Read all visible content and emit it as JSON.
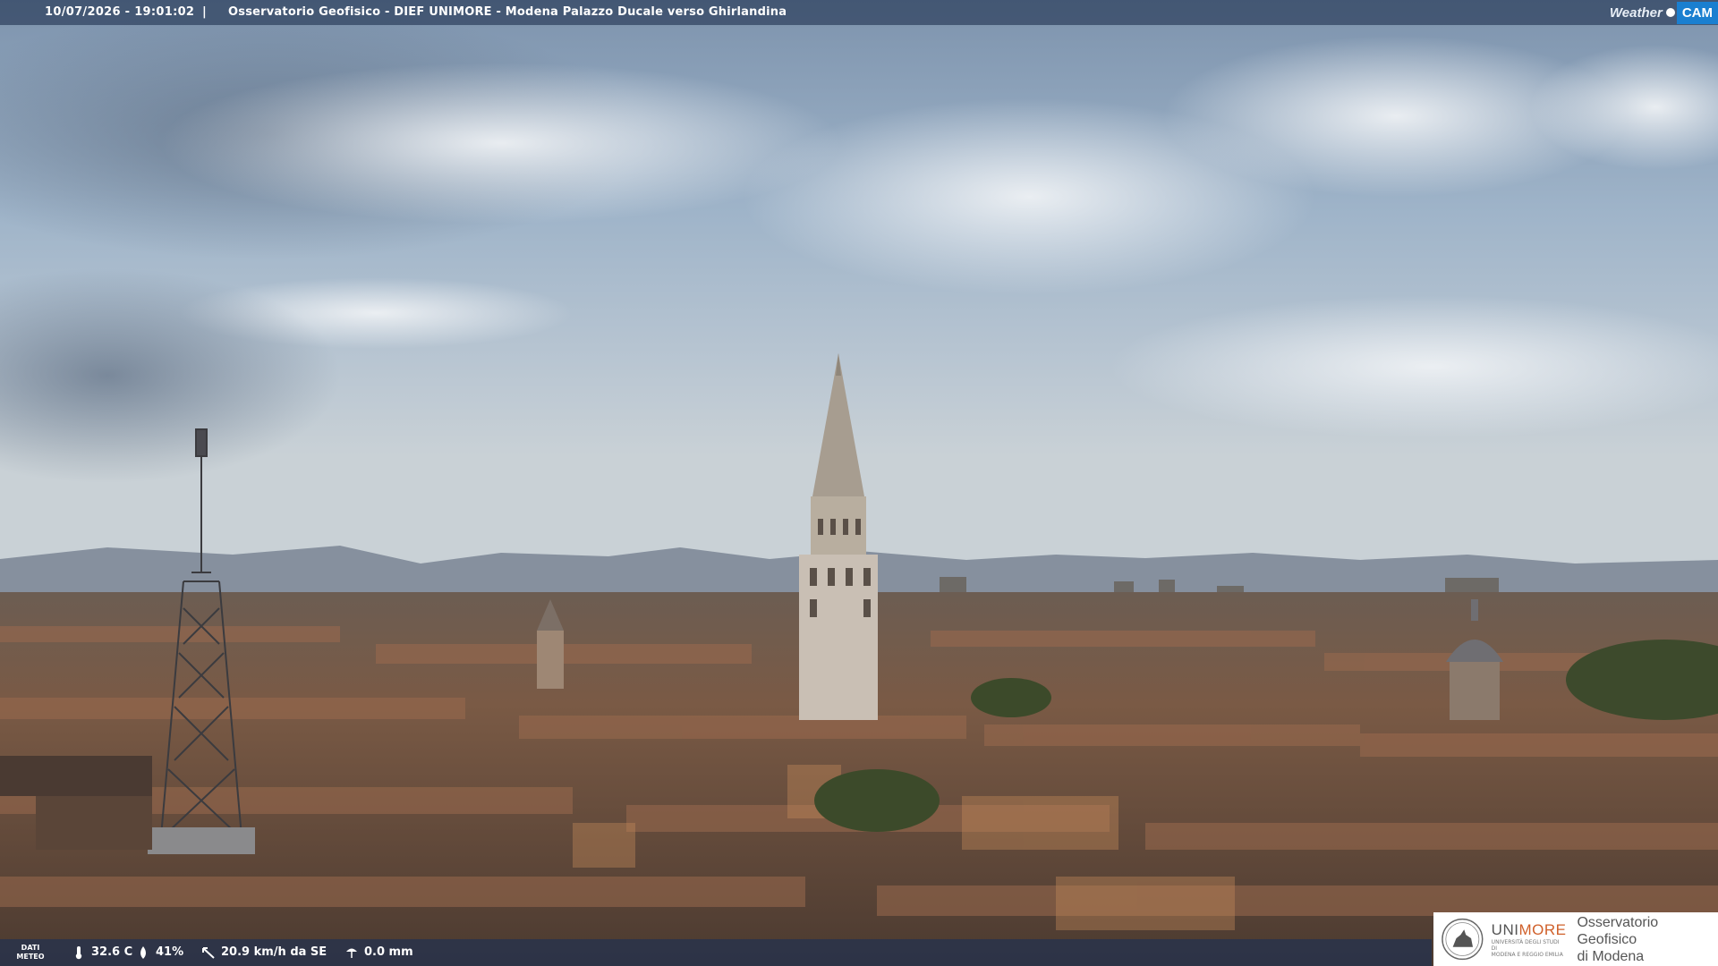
{
  "header": {
    "timestamp": "10/07/2026 - 19:01:02",
    "separator": "|",
    "title": "Osservatorio Geofisico - DIEF UNIMORE - Modena Palazzo Ducale verso Ghirlandina"
  },
  "logo": {
    "weather_text": "Weather",
    "cam_text": "CAM",
    "icon": "weathercam-logo"
  },
  "meteo": {
    "label_line1": "DATI",
    "label_line2": "METEO",
    "temperature": "32.6 C",
    "humidity": "41%",
    "wind": "20.9 km/h da SE",
    "rain": "0.0 mm",
    "icons": [
      "thermometer-icon",
      "humidity-drop-icon",
      "wind-icon",
      "rain-icon"
    ]
  },
  "brand": {
    "uni_prefix": "UNI",
    "uni_suffix": "MORE",
    "uni_sub_line1": "UNIVERSITÀ DEGLI STUDI DI",
    "uni_sub_line2": "MODENA E REGGIO EMILIA",
    "observatory_line1": "Osservatorio Geofisico",
    "observatory_line2": "di Modena",
    "accent_color": "#d0602a"
  }
}
